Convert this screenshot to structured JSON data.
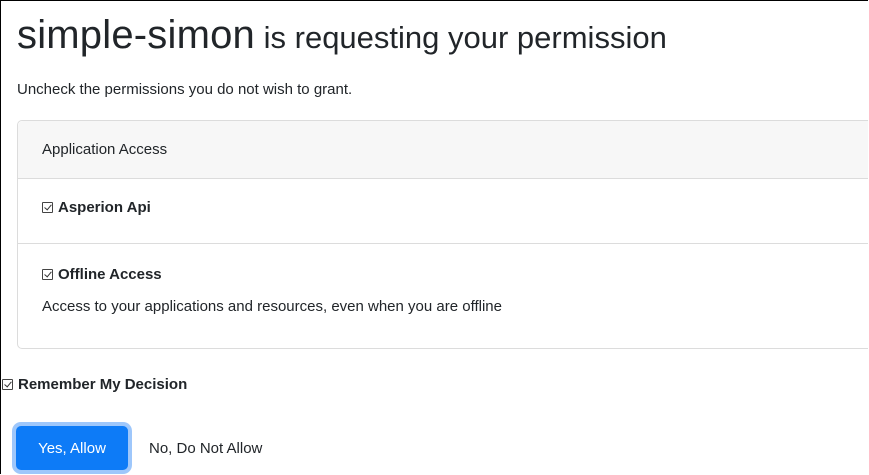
{
  "header": {
    "app_name": "simple-simon",
    "title_rest": " is requesting your permission",
    "subtitle": "Uncheck the permissions you do not wish to grant."
  },
  "card": {
    "header": "Application Access",
    "permissions": [
      {
        "label": "Asperion Api",
        "checked": true,
        "description": ""
      },
      {
        "label": "Offline Access",
        "checked": true,
        "description": "Access to your applications and resources, even when you are offline"
      }
    ]
  },
  "remember": {
    "label": "Remember My Decision",
    "checked": true
  },
  "buttons": {
    "allow_label": "Yes, Allow",
    "deny_label": "No, Do Not Allow"
  },
  "colors": {
    "primary": "#0d7bf7",
    "focus_ring": "#9ec7fb",
    "card_header_bg": "#f7f7f7",
    "border": "#dcdcdc",
    "text": "#212529"
  }
}
